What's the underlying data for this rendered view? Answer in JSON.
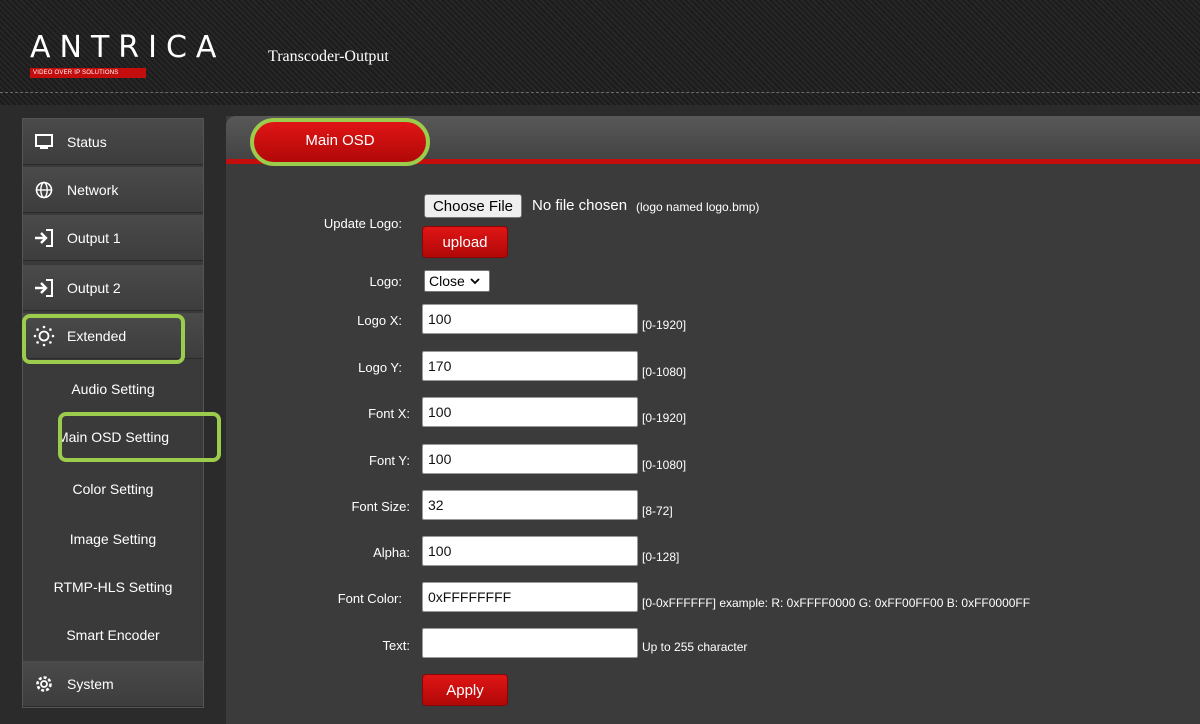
{
  "header": {
    "brand": "ANTRICA",
    "brand_tagline": "VIDEO OVER IP SOLUTIONS",
    "page_title": "Transcoder-Output"
  },
  "sidebar": {
    "items": [
      {
        "label": "Status",
        "icon": "monitor-icon"
      },
      {
        "label": "Network",
        "icon": "globe-icon"
      },
      {
        "label": "Output 1",
        "icon": "arrow-in-icon"
      },
      {
        "label": "Output 2",
        "icon": "arrow-in-icon"
      },
      {
        "label": "Extended",
        "icon": "sun-gear-icon"
      }
    ],
    "sub_items": [
      {
        "label": "Audio Setting"
      },
      {
        "label": "Main OSD Setting"
      },
      {
        "label": "Color Setting"
      },
      {
        "label": "Image Setting"
      },
      {
        "label": "RTMP-HLS Setting"
      },
      {
        "label": "Smart Encoder"
      }
    ],
    "system": {
      "label": "System",
      "icon": "gear-icon"
    }
  },
  "main": {
    "tab_label": "Main OSD",
    "update_logo": {
      "label": "Update Logo:",
      "choose_file": "Choose File",
      "no_file": "No file chosen",
      "hint": "(logo named logo.bmp)",
      "upload": "upload"
    },
    "logo": {
      "label": "Logo:",
      "value": "Close"
    },
    "fields": [
      {
        "label": "Logo X:",
        "value": "100",
        "hint": "[0-1920]"
      },
      {
        "label": "Logo Y:",
        "value": "170",
        "hint": "[0-1080]"
      },
      {
        "label": "Font X:",
        "value": "100",
        "hint": "[0-1920]"
      },
      {
        "label": "Font Y:",
        "value": "100",
        "hint": "[0-1080]"
      },
      {
        "label": "Font Size:",
        "value": "32",
        "hint": "[8-72]"
      },
      {
        "label": "Alpha:",
        "value": "100",
        "hint": "[0-128]"
      },
      {
        "label": "Font Color:",
        "value": "0xFFFFFFFF",
        "hint": "[0-0xFFFFFF] example:  R: 0xFFFF0000 G: 0xFF00FF00 B: 0xFF0000FF"
      },
      {
        "label": "Text:",
        "value": "",
        "hint": "Up to 255 character"
      }
    ],
    "apply": "Apply"
  },
  "colors": {
    "accent_red": "#c40d0d",
    "highlight_green": "#9ccc4c",
    "sidebar_bg": "#3a3a3a"
  }
}
